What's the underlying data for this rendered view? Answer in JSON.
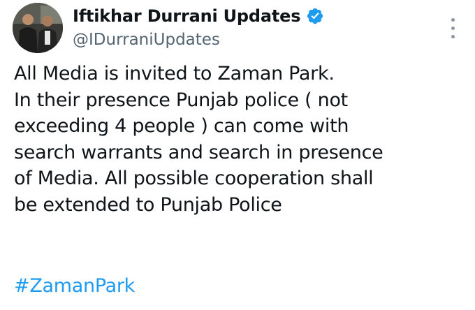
{
  "author": {
    "display_name": "Iftikhar Durrani Updates",
    "handle": "@IDurraniUpdates",
    "verified": true,
    "avatar_icon": "profile-photo"
  },
  "menu": {
    "icon": "more-vertical-icon"
  },
  "tweet": {
    "lines": [
      "All Media is invited to Zaman Park.",
      "In their presence Punjab police ( not",
      "exceeding 4 people ) can come with",
      "search warrants and search in presence",
      "of Media. All possible cooperation shall",
      "be extended to Punjab Police"
    ],
    "hashtag": "#ZamanPark"
  },
  "colors": {
    "text": "#0f1419",
    "secondary": "#536471",
    "link": "#1d9bf0",
    "verified": "#1d9bf0"
  }
}
